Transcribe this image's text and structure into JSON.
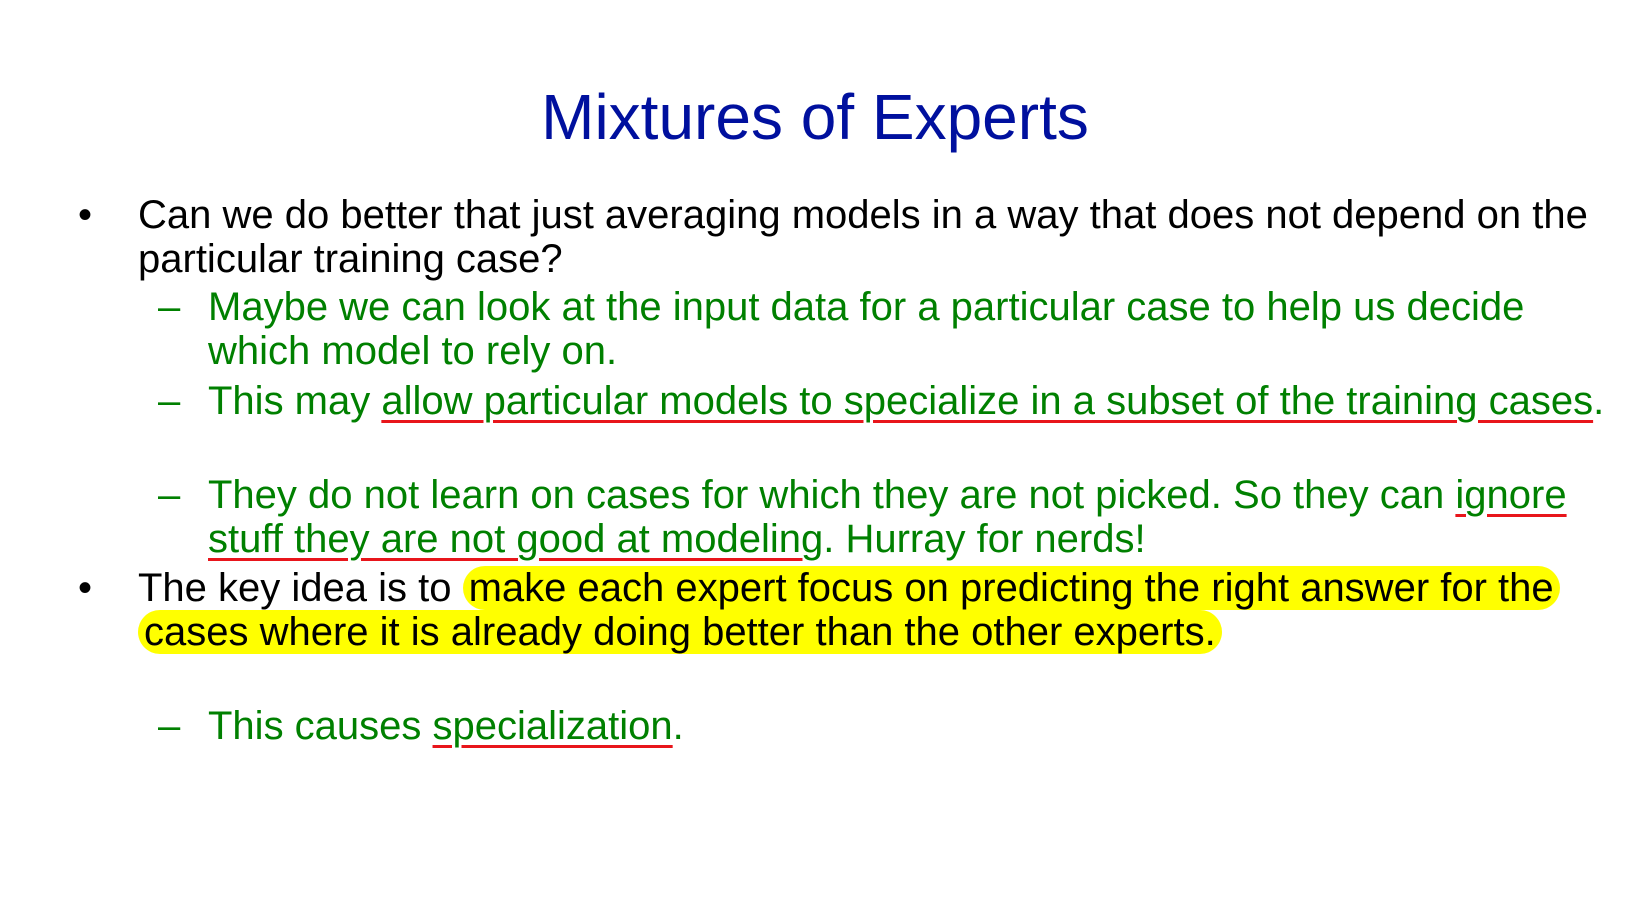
{
  "slide": {
    "title": "Mixtures of Experts",
    "bullet_glyph": "•",
    "dash_glyph": "–",
    "colors": {
      "title": "#00109e",
      "level1_text": "#000000",
      "level2_text": "#008000",
      "underline": "#e8151b",
      "highlight": "#ffff00"
    },
    "bullet1": {
      "text": "Can we do better that just averaging models in a way that does not depend on the particular training case?"
    },
    "sub1": {
      "text": "Maybe we can look at the input data for a particular case to help us decide which model to rely on."
    },
    "sub2": {
      "pre": "This may ",
      "underlined": "allow particular models to specialize in a subset of the training cases",
      "post": "."
    },
    "sub3": {
      "pre": "They do not learn on cases for which they are not picked. So they can ",
      "underlined": "ignore stuff they are not good at modeling",
      "post": ". Hurray for nerds!"
    },
    "bullet2": {
      "pre": "The key idea is to ",
      "highlighted": "make each expert focus on predicting the right answer for the cases where it is already doing better than the other experts.",
      "post": ""
    },
    "sub4": {
      "pre": "This causes ",
      "underlined": "specialization",
      "post": "."
    }
  }
}
